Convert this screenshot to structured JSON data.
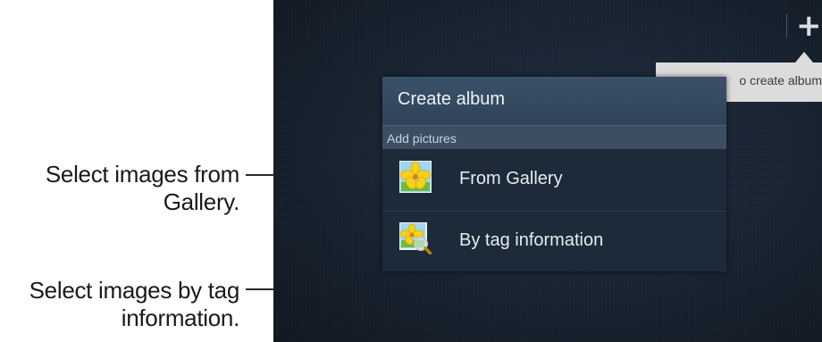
{
  "annotations": {
    "gallery_callout": "Select images from Gallery.",
    "tag_callout": "Select images by tag information."
  },
  "screen": {
    "action_icon": "plus-icon",
    "tooltip_text": "o create album"
  },
  "dialog": {
    "title": "Create album",
    "section_label": "Add pictures",
    "items": [
      {
        "label": "From Gallery",
        "icon": "gallery-flower-icon"
      },
      {
        "label": "By tag information",
        "icon": "tag-search-icon"
      }
    ]
  },
  "colors": {
    "dialog_background": "#1c2a39",
    "dialog_header": "#3b5168",
    "screen_background": "#17222f"
  }
}
